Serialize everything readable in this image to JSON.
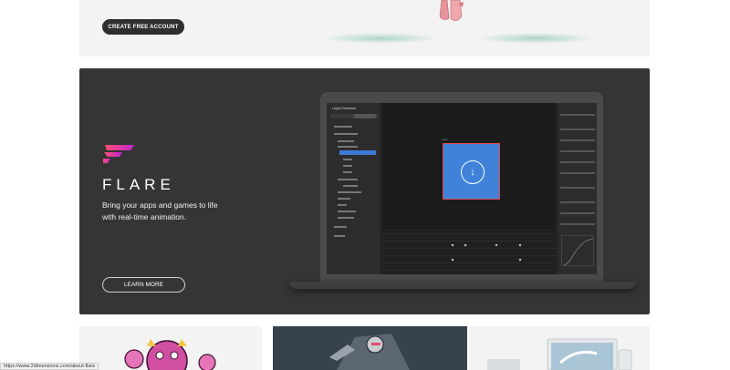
{
  "top_card": {
    "cta_label": "CREATE FREE ACCOUNT"
  },
  "flare": {
    "title": "FLARE",
    "description": "Bring your apps and games to life with real-time animation.",
    "learn_more_label": "LEARN MORE",
    "brand_gradient": [
      "#ff4d6d",
      "#c026d3"
    ],
    "app": {
      "file_title": "Liquid Download",
      "center_artboard_color": "#3f82d8"
    }
  },
  "status_bar": {
    "url": "https://www.2dimensions.com/about-flare"
  },
  "colors": {
    "dark_card": "#353535",
    "light_card": "#f3f3f3",
    "cta_bg": "#2f2f2f"
  }
}
